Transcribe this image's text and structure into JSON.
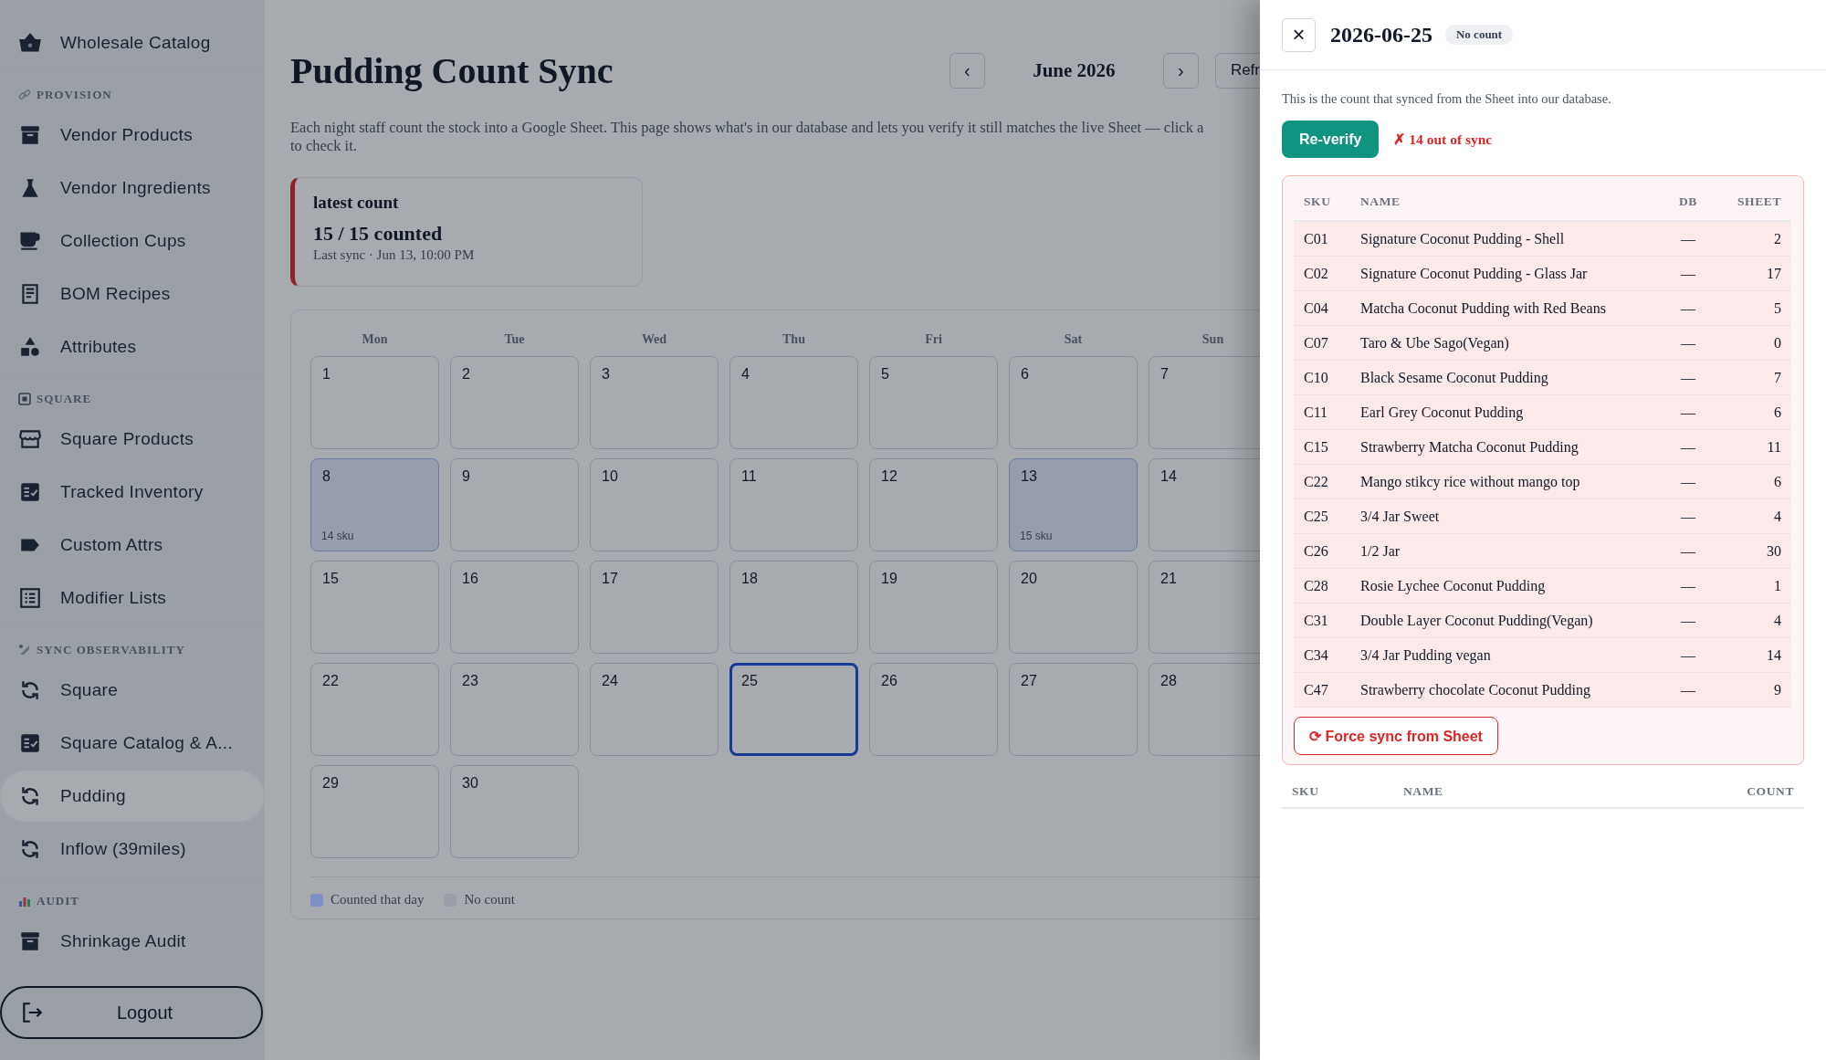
{
  "sidebar": {
    "groups": [
      {
        "items": [
          {
            "label": "Wholesale Catalog",
            "selected": false
          }
        ]
      },
      {
        "title": "PROVISION",
        "items": [
          {
            "label": "Vendor Products",
            "selected": false
          },
          {
            "label": "Vendor Ingredients",
            "selected": false
          },
          {
            "label": "Collection Cups",
            "selected": false
          },
          {
            "label": "BOM Recipes",
            "selected": false
          },
          {
            "label": "Attributes",
            "selected": false
          }
        ]
      },
      {
        "title": "SQUARE",
        "items": [
          {
            "label": "Square Products",
            "selected": false
          },
          {
            "label": "Tracked Inventory",
            "selected": false
          },
          {
            "label": "Custom Attrs",
            "selected": false
          },
          {
            "label": "Modifier Lists",
            "selected": false
          }
        ]
      },
      {
        "title": "SYNC OBSERVABILITY",
        "items": [
          {
            "label": "Square",
            "selected": false
          },
          {
            "label": "Square Catalog & A...",
            "selected": false
          },
          {
            "label": "Pudding",
            "selected": true
          },
          {
            "label": "Inflow (39miles)",
            "selected": false
          }
        ]
      },
      {
        "title": "AUDIT",
        "items": [
          {
            "label": "Shrinkage Audit",
            "selected": false
          }
        ]
      }
    ],
    "logout": "Logout"
  },
  "header": {
    "title": "Pudding Count Sync",
    "prev": "‹",
    "month": "June 2026",
    "next": "›",
    "refresh": "Refr"
  },
  "description": [
    "Each night staff count the stock into a Google Sheet. This page shows what's in our database and lets you verify it still matches the live Sheet — click a",
    "to check it."
  ],
  "latest": {
    "label": "latest count",
    "value": "15 / 15 counted",
    "sub": "Last sync · Jun 13, 10:00 PM"
  },
  "calendar": {
    "weekdays": [
      "Mon",
      "Tue",
      "Wed",
      "Thu",
      "Fri",
      "Sat",
      "Sun"
    ],
    "days": [
      {
        "day": "1",
        "counted": false,
        "selected": false
      },
      {
        "day": "2",
        "counted": false,
        "selected": false
      },
      {
        "day": "3",
        "counted": false,
        "selected": false
      },
      {
        "day": "4",
        "counted": false,
        "selected": false
      },
      {
        "day": "5",
        "counted": false,
        "selected": false
      },
      {
        "day": "6",
        "counted": false,
        "selected": false
      },
      {
        "day": "7",
        "counted": false,
        "selected": false
      },
      {
        "day": "8",
        "counted": true,
        "selected": false,
        "note": "14 sku"
      },
      {
        "day": "9",
        "counted": false,
        "selected": false
      },
      {
        "day": "10",
        "counted": false,
        "selected": false
      },
      {
        "day": "11",
        "counted": false,
        "selected": false
      },
      {
        "day": "12",
        "counted": false,
        "selected": false
      },
      {
        "day": "13",
        "counted": true,
        "selected": false,
        "note": "15 sku"
      },
      {
        "day": "14",
        "counted": false,
        "selected": false
      },
      {
        "day": "15",
        "counted": false,
        "selected": false
      },
      {
        "day": "16",
        "counted": false,
        "selected": false
      },
      {
        "day": "17",
        "counted": false,
        "selected": false
      },
      {
        "day": "18",
        "counted": false,
        "selected": false
      },
      {
        "day": "19",
        "counted": false,
        "selected": false
      },
      {
        "day": "20",
        "counted": false,
        "selected": false
      },
      {
        "day": "21",
        "counted": false,
        "selected": false
      },
      {
        "day": "22",
        "counted": false,
        "selected": false
      },
      {
        "day": "23",
        "counted": false,
        "selected": false
      },
      {
        "day": "24",
        "counted": false,
        "selected": false
      },
      {
        "day": "25",
        "counted": false,
        "selected": true
      },
      {
        "day": "26",
        "counted": false,
        "selected": false
      },
      {
        "day": "27",
        "counted": false,
        "selected": false
      },
      {
        "day": "28",
        "counted": false,
        "selected": false
      },
      {
        "day": "29",
        "counted": false,
        "selected": false
      },
      {
        "day": "30",
        "counted": false,
        "selected": false
      }
    ]
  },
  "legend": [
    {
      "label": "Counted that day",
      "color": "#7d8fc6"
    },
    {
      "label": "No count",
      "color": "#9a9ea8"
    }
  ],
  "panel": {
    "close": "×",
    "date": "2026-06-25",
    "badge": "No count",
    "note": "This is the count that synced from the Sheet into our database.",
    "reverify": "Re-verify",
    "status": "✗ 14 out of sync",
    "mismatch": {
      "columns": [
        "SKU",
        "NAME",
        "DB",
        "SHEET"
      ],
      "rows": [
        {
          "sku": "C01",
          "name": "Signature Coconut Pudding - Shell",
          "db": "—",
          "sheet": "2"
        },
        {
          "sku": "C02",
          "name": "Signature Coconut Pudding - Glass Jar",
          "db": "—",
          "sheet": "17"
        },
        {
          "sku": "C04",
          "name": "Matcha Coconut Pudding with Red Beans",
          "db": "—",
          "sheet": "5"
        },
        {
          "sku": "C07",
          "name": "Taro & Ube Sago(Vegan)",
          "db": "—",
          "sheet": "0"
        },
        {
          "sku": "C10",
          "name": "Black Sesame Coconut Pudding",
          "db": "—",
          "sheet": "7"
        },
        {
          "sku": "C11",
          "name": "Earl Grey Coconut Pudding",
          "db": "—",
          "sheet": "6"
        },
        {
          "sku": "C15",
          "name": "Strawberry Matcha Coconut Pudding",
          "db": "—",
          "sheet": "11"
        },
        {
          "sku": "C22",
          "name": "Mango stikcy rice without mango top",
          "db": "—",
          "sheet": "6"
        },
        {
          "sku": "C25",
          "name": "3/4 Jar Sweet",
          "db": "—",
          "sheet": "4"
        },
        {
          "sku": "C26",
          "name": "1/2 Jar",
          "db": "—",
          "sheet": "30"
        },
        {
          "sku": "C28",
          "name": "Rosie Lychee Coconut Pudding",
          "db": "—",
          "sheet": "1"
        },
        {
          "sku": "C31",
          "name": "Double Layer Coconut Pudding(Vegan)",
          "db": "—",
          "sheet": "4"
        },
        {
          "sku": "C34",
          "name": "3/4 Jar Pudding vegan",
          "db": "—",
          "sheet": "14"
        },
        {
          "sku": "C47",
          "name": "Strawberry chocolate Coconut Pudding",
          "db": "—",
          "sheet": "9"
        }
      ],
      "force": "⟳ Force sync from Sheet"
    },
    "counts": {
      "columns": [
        "SKU",
        "NAME",
        "COUNT"
      ]
    }
  }
}
